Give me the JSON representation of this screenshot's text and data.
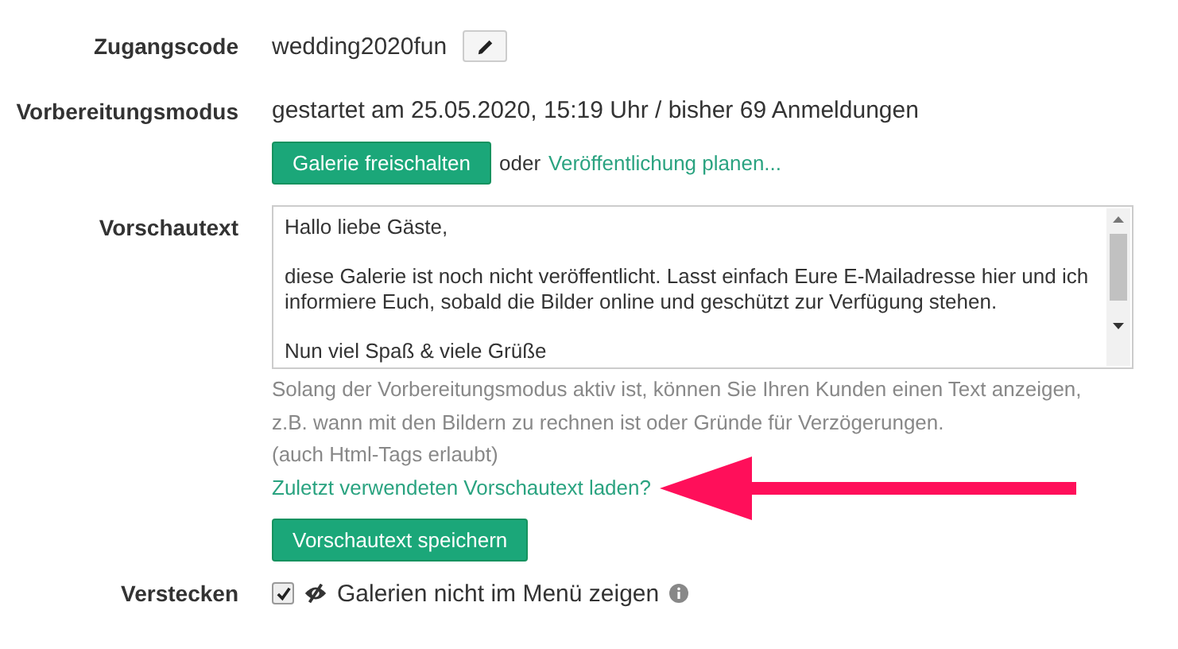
{
  "access_code": {
    "label": "Zugangscode",
    "value": "wedding2020fun"
  },
  "preparation_mode": {
    "label": "Vorbereitungsmodus",
    "status": "gestartet am 25.05.2020, 15:19 Uhr / bisher 69 Anmeldungen",
    "unlock_button": "Galerie freischalten",
    "or_text": "oder",
    "schedule_link": "Veröffentlichung planen..."
  },
  "preview_text": {
    "label": "Vorschautext",
    "paragraphs": [
      "Hallo liebe Gäste,",
      "diese Galerie ist noch nicht veröffentlicht. Lasst einfach Eure E-Mailadresse hier und ich informiere Euch, sobald die Bilder online und geschützt zur Verfügung stehen.",
      "Nun viel Spaß & viele Grüße"
    ],
    "help": [
      "Solang der Vorbereitungsmodus aktiv ist, können Sie Ihren Kunden einen Text anzeigen,",
      "z.B. wann mit den Bildern zu rechnen ist oder Gründe für Verzögerungen.",
      "(auch Html-Tags erlaubt)"
    ],
    "load_link": "Zuletzt verwendeten Vorschautext laden?",
    "save_button": "Vorschautext speichern"
  },
  "hide": {
    "label": "Verstecken",
    "checked": true,
    "text": "Galerien nicht im Menü zeigen"
  }
}
